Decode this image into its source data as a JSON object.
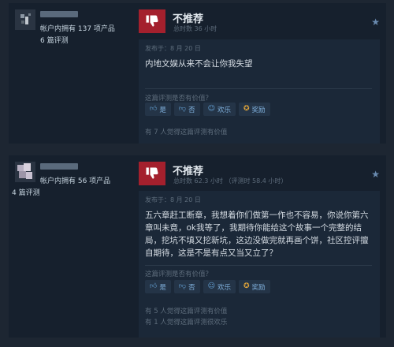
{
  "reviews": [
    {
      "author": {
        "products_text": "帐户内拥有 137 项产品",
        "reviews_text": "6 篇评测"
      },
      "verdict": "不推荐",
      "hours": "总时数 36 小时",
      "posted": "发布于：8 月 20 日",
      "text": "内地文娱从来不会让你我失望",
      "helpful_question": "这篇评测是否有价值？",
      "buttons": {
        "yes": "是",
        "no": "否",
        "funny": "欢乐",
        "award": "奖励"
      },
      "stats": [
        "有 7 人觉得这篇评测有价值"
      ]
    },
    {
      "author": {
        "products_text": "帐户内拥有 56 项产品",
        "reviews_text": "4 篇评测"
      },
      "verdict": "不推荐",
      "hours": "总时数 62.3 小时 （评测时 58.4 小时）",
      "posted": "发布于：8 月 20 日",
      "text": "五六章赶工断章，我想着你们做第一作也不容易，你说你第六章叫未竟，ok我等了，我期待你能给这个故事一个完整的结局，挖坑不填又挖新坑，这边没做完就再画个饼，社区控评擅自期待，这是不是有点又当又立了？",
      "helpful_question": "这篇评测是否有价值？",
      "buttons": {
        "yes": "是",
        "no": "否",
        "funny": "欢乐",
        "award": "奖励"
      },
      "stats": [
        "有 5 人觉得这篇评测有价值",
        "有 1 人觉得这篇评测很欢乐"
      ]
    }
  ],
  "colors": {
    "page_bg": "#1d2632",
    "card_bg": "#16202d",
    "content_bg": "#1b2838",
    "not_recommended": "#a4202d",
    "button_text": "#7fb0dc"
  },
  "icons": {
    "verdict": "thumbs-down-icon",
    "star": "star-icon",
    "yes": "thumbs-up-icon",
    "no": "thumbs-down-icon",
    "funny": "smiley-icon",
    "award": "award-icon"
  }
}
